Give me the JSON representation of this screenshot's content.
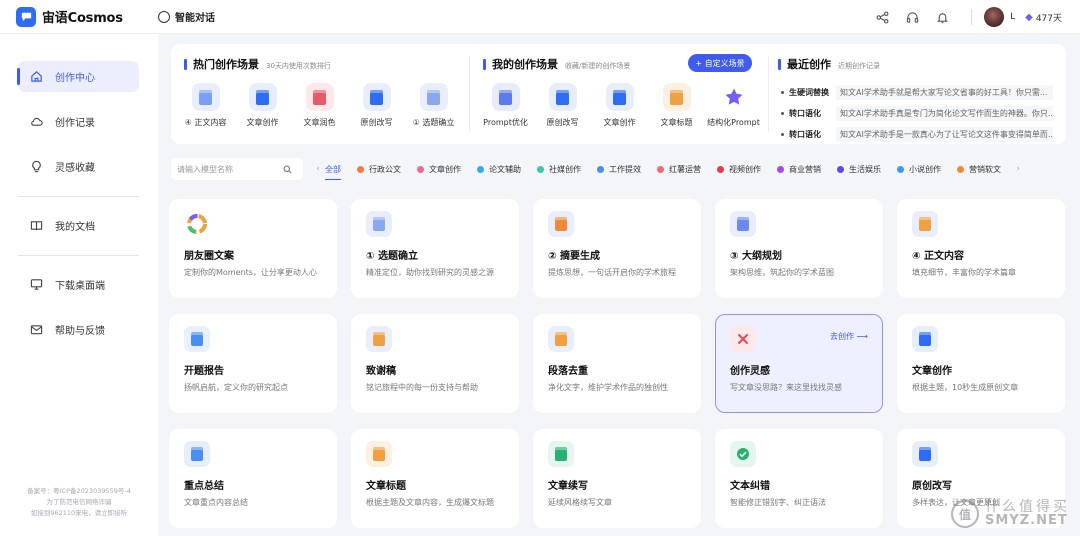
{
  "header": {
    "logo_text": "宙语Cosmos",
    "page_title": "智能对话",
    "user_name": "L",
    "vip_days": "477天"
  },
  "sidebar": {
    "items": [
      {
        "label": "创作中心",
        "icon": "home-icon",
        "active": true
      },
      {
        "label": "创作记录",
        "icon": "cloud-icon"
      },
      {
        "label": "灵感收藏",
        "icon": "bulb-icon"
      },
      {
        "label": "我的文档",
        "icon": "book-icon"
      },
      {
        "label": "下载桌面端",
        "icon": "monitor-icon"
      },
      {
        "label": "帮助与反馈",
        "icon": "mail-icon"
      }
    ],
    "icp_lines": [
      "备案号：粤ICP备2023039559号-4",
      "为了防范电信网络诈骗",
      "如接到962110来电，请立即接听"
    ]
  },
  "hot_scenes": {
    "title": "热门创作场景",
    "subtitle": "30天内使用次数排行",
    "items": [
      {
        "label": "④ 正文内容",
        "icon": "doc-list-icon",
        "color": "#e8eefc",
        "accent": "#7aa0f5"
      },
      {
        "label": "文章创作",
        "icon": "blue-book-icon",
        "color": "#e6eefc",
        "accent": "#2f6cf6"
      },
      {
        "label": "文章润色",
        "icon": "red-book-icon",
        "color": "#fde8ea",
        "accent": "#e85a6a"
      },
      {
        "label": "原创改写",
        "icon": "rewrite-icon",
        "color": "#e6eefc",
        "accent": "#2f6cf6"
      },
      {
        "label": "① 选题确立",
        "icon": "topic-icon",
        "color": "#e8eefc",
        "accent": "#8aa8f0"
      }
    ]
  },
  "my_scenes": {
    "title": "我的创作场景",
    "subtitle": "收藏/新建的创作场景",
    "custom_button": "+ 自定义场景",
    "items": [
      {
        "label": "Prompt优化",
        "icon": "prompt-icon",
        "color": "#e6ecfc",
        "accent": "#5a7cf0"
      },
      {
        "label": "原创改写",
        "icon": "rewrite-icon",
        "color": "#e6eefc",
        "accent": "#2f6cf6"
      },
      {
        "label": "文章创作",
        "icon": "blue-book-icon",
        "color": "#e6eefc",
        "accent": "#2f6cf6"
      },
      {
        "label": "文章标题",
        "icon": "title-icon",
        "color": "#fdf0e0",
        "accent": "#f0a040"
      },
      {
        "label": "结构化Prompt",
        "icon": "star-icon",
        "color": "#ffffff",
        "accent": "#7a5cf0"
      }
    ]
  },
  "recent": {
    "title": "最近创作",
    "subtitle": "近期创作记录",
    "items": [
      {
        "tag": "生硬词替换",
        "text": "知文AI学术助手就是帮大家写论文省事的好工具！你只需..."
      },
      {
        "tag": "转口语化",
        "text": "知文AI学术助手真是专门为简化论文写作而生的神器。你只..."
      },
      {
        "tag": "转口语化",
        "text": "知文AI学术助手是一款真心为了让写论文这件事变得简单而..."
      }
    ]
  },
  "search": {
    "placeholder": "请输入模型名称"
  },
  "categories": [
    {
      "label": "全部",
      "color": "",
      "active": true
    },
    {
      "label": "行政公文",
      "color": "#f07a4a"
    },
    {
      "label": "文章创作",
      "color": "#f06a8a"
    },
    {
      "label": "论文辅助",
      "color": "#3aa8f0"
    },
    {
      "label": "社媒创作",
      "color": "#3ac8b0"
    },
    {
      "label": "工作提效",
      "color": "#4a8ef0"
    },
    {
      "label": "红薯运营",
      "color": "#f06a7a"
    },
    {
      "label": "视频创作",
      "color": "#e83a4a"
    },
    {
      "label": "商业营销",
      "color": "#a04af0"
    },
    {
      "label": "生活娱乐",
      "color": "#5a4af0"
    },
    {
      "label": "小说创作",
      "color": "#3a9af0"
    },
    {
      "label": "营销软文",
      "color": "#f08a3a"
    }
  ],
  "cards": [
    {
      "title": "朋友圈文案",
      "desc": "定制你的Moments，让分享更动人心",
      "icon": "ring-icon",
      "color": "#ffffff",
      "accent": "#f0a040"
    },
    {
      "title": "① 选题确立",
      "desc": "精准定位，助你找到研究的灵感之源",
      "icon": "topic-icon",
      "color": "#e8eefc",
      "accent": "#8aa8f0"
    },
    {
      "title": "② 摘要生成",
      "desc": "提炼思想，一句话开启你的学术旅程",
      "icon": "summary-icon",
      "color": "#e8eefc",
      "accent": "#f08a3a"
    },
    {
      "title": "③ 大纲规划",
      "desc": "架构思维，筑起你的学术蓝图",
      "icon": "outline-icon",
      "color": "#e8eefc",
      "accent": "#6a8af0"
    },
    {
      "title": "④ 正文内容",
      "desc": "填充细节，丰富你的学术篇章",
      "icon": "doc-list-icon",
      "color": "#e8eefc",
      "accent": "#f0a040"
    },
    {
      "title": "开题报告",
      "desc": "扬帆启航，定义你的研究起点",
      "icon": "report-icon",
      "color": "#e8f0fc",
      "accent": "#4a8ef0"
    },
    {
      "title": "致谢稿",
      "desc": "铭记旅程中的每一份支持与帮助",
      "icon": "thanks-icon",
      "color": "#e8eefc",
      "accent": "#f0a040"
    },
    {
      "title": "段落去重",
      "desc": "净化文字，维护学术作品的独创性",
      "icon": "dedupe-icon",
      "color": "#e8eefc",
      "accent": "#f0a040"
    },
    {
      "title": "创作灵感",
      "desc": "写文章没思路？来这里找找灵感",
      "icon": "inspire-icon",
      "color": "#fde8ea",
      "accent": "#e84a5a",
      "goto": "去创作 ⟶"
    },
    {
      "title": "文章创作",
      "desc": "根据主题，10秒生成原创文章",
      "icon": "blue-book-icon",
      "color": "#e6eefc",
      "accent": "#2f6cf6"
    },
    {
      "title": "重点总结",
      "desc": "文章重点内容总结",
      "icon": "keypoint-icon",
      "color": "#e6eefc",
      "accent": "#4a8ef0"
    },
    {
      "title": "文章标题",
      "desc": "根据主题及文章内容，生成爆文标题",
      "icon": "title-icon",
      "color": "#fdf0e0",
      "accent": "#f0a040"
    },
    {
      "title": "文章续写",
      "desc": "延续风格续写文章",
      "icon": "continue-icon",
      "color": "#e4f6ee",
      "accent": "#2ab070"
    },
    {
      "title": "文本纠错",
      "desc": "智能修正错别字、纠正语法",
      "icon": "check-icon",
      "color": "#e4f6ee",
      "accent": "#2ab070"
    },
    {
      "title": "原创改写",
      "desc": "多样表达，让文章更原创",
      "icon": "rewrite-icon",
      "color": "#e6eefc",
      "accent": "#2f6cf6"
    }
  ],
  "watermark": {
    "line1": "什么值得买",
    "line2": "SMYZ.NET",
    "mark": "值"
  }
}
